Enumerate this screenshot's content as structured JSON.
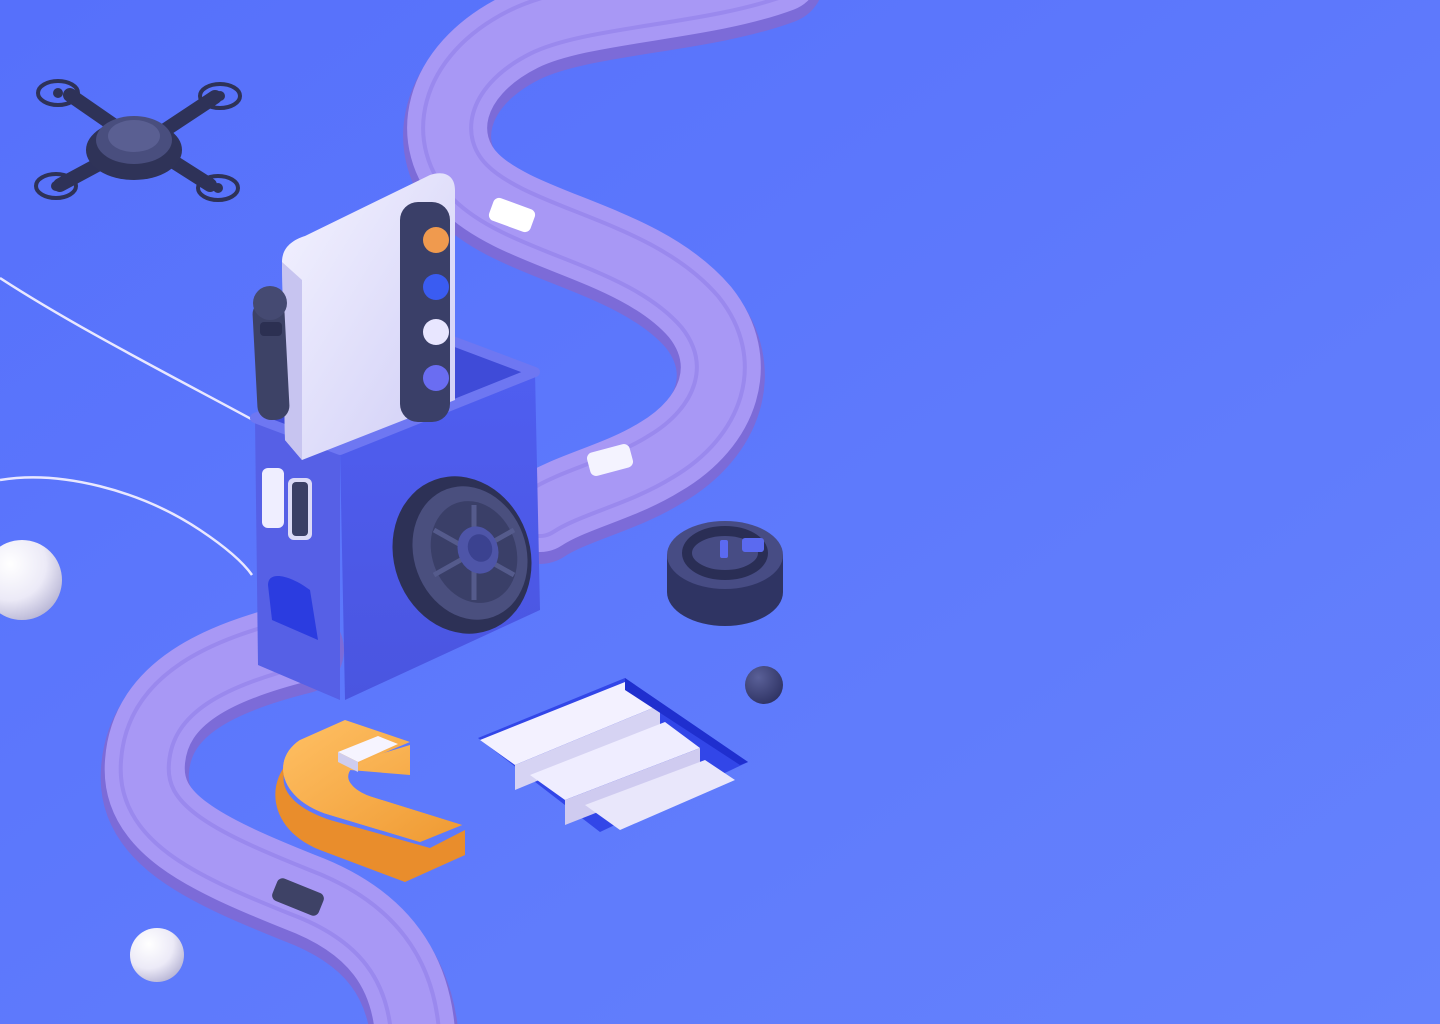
{
  "scene": {
    "background": "#5d78fc",
    "colors": {
      "track": "#a595f4",
      "track_edge": "#8e7ee6",
      "box": "#5a62ee",
      "box_dark": "#3f46c9",
      "phone": "#e7e6fb",
      "orange": "#f5a53c",
      "slate": "#3d4266",
      "white_ball": "#f2f2fa",
      "dark_ball": "#3a3f72",
      "light_panel": "#f09a4e",
      "light_blue": "#3a5cf2",
      "light_white": "#e8e6ff",
      "light_indigo": "#6a6df2"
    },
    "objects": [
      "drone-icon",
      "winding-track",
      "phone-holder-box",
      "smartphone",
      "indicator-light-panel",
      "stylus-pen",
      "wheel",
      "power-button",
      "stairs-opening",
      "orange-s-block",
      "white-spheres",
      "dark-sphere",
      "cables"
    ]
  }
}
